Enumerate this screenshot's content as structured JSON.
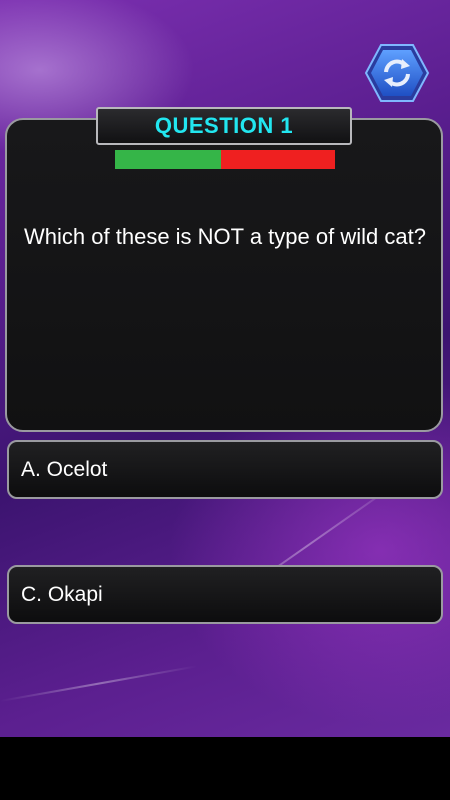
{
  "header": {
    "title": "QUESTION 1",
    "timer_remaining_fraction": 0.48
  },
  "question": {
    "text": "Which of these is NOT a type of wild cat?"
  },
  "answers": [
    {
      "label": "A. Ocelot"
    },
    {
      "label": "C. Okapi"
    }
  ],
  "colors": {
    "title": "#22e6f0",
    "timer_remaining": "#35b548",
    "timer_elapsed": "#ef2020",
    "background": "#5a1e8f"
  },
  "icons": {
    "refresh": "refresh-icon"
  }
}
